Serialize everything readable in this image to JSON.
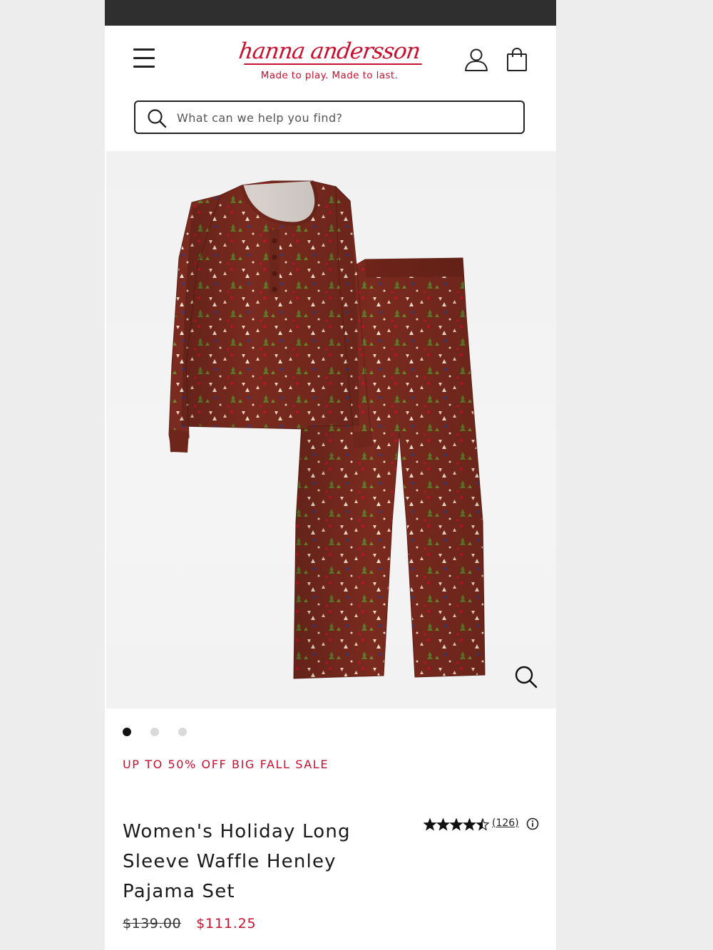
{
  "header": {
    "brand_name": "hanna andersson",
    "tagline": "Made to play. Made to last.",
    "menu_icon": "hamburger-menu-icon",
    "account_icon": "user-account-icon",
    "bag_icon": "shopping-bag-icon"
  },
  "search": {
    "placeholder": "What can we help you find?",
    "value": "",
    "icon": "search-icon"
  },
  "gallery": {
    "image_count": 3,
    "active_index": 0,
    "zoom_icon": "zoom-icon"
  },
  "product": {
    "promo": "UP TO 50% OFF BIG FALL SALE",
    "title": "Women's Holiday Long Sleeve Waffle Henley Pajama Set",
    "rating": 4.5,
    "rating_max": 5,
    "review_count": "(126)",
    "price_original": "$139.00",
    "price_sale": "$111.25"
  },
  "colors": {
    "brand_red": "#c8102e",
    "fabric": "#7a2a1e",
    "status_bar": "#2f2f2f",
    "dot_active": "#111111",
    "dot_inactive": "#d9d9d9"
  }
}
